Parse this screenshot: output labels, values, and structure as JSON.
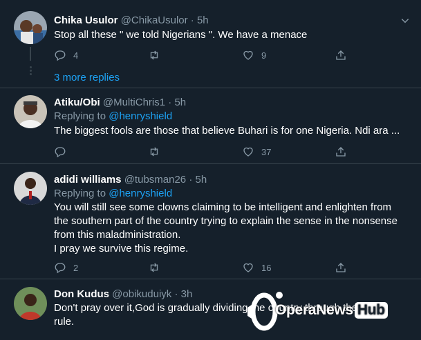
{
  "tweets": [
    {
      "name": "Chika Usulor",
      "handle": "@ChikaUsulor",
      "dot": "·",
      "time": "5h",
      "replying_label": "",
      "replying_to": "",
      "text": [
        "Stop all these \" we told Nigerians \". We have a menace"
      ],
      "replies": "4",
      "retweets": "",
      "likes": "9"
    },
    {
      "name": "Atiku/Obi",
      "handle": "@MultiChris1",
      "dot": "·",
      "time": "5h",
      "replying_label": "Replying to",
      "replying_to": "@henryshield",
      "text": [
        "The biggest fools are those that believe Buhari is for one Nigeria.  Ndi ara ..."
      ],
      "replies": "",
      "retweets": "",
      "likes": "37"
    },
    {
      "name": "adidi williams",
      "handle": "@tubsman26",
      "dot": "·",
      "time": "5h",
      "replying_label": "Replying to",
      "replying_to": "@henryshield",
      "text": [
        "You will still see some clowns claiming to be intelligent and enlighten from",
        "the southern part of the country trying to explain the sense in the nonsense",
        "from this maladministration.",
        "I pray we survive this regime."
      ],
      "replies": "2",
      "retweets": "",
      "likes": "16"
    },
    {
      "name": "Don Kudus",
      "handle": "@obikuduiyk",
      "dot": "·",
      "time": "3h",
      "replying_label": "",
      "replying_to": "",
      "text": [
        "Don't pray over it,God is gradually dividing the country through the be",
        "rule."
      ],
      "replies": "",
      "retweets": "",
      "likes": ""
    }
  ],
  "more_replies": "3 more replies",
  "watermark": {
    "brand": "OperaNews",
    "hub": "Hub"
  },
  "colors": {
    "background": "#15202b",
    "border": "#38444d",
    "muted": "#8899a6",
    "accent": "#1da1f2",
    "text": "#ffffff"
  },
  "icons": {
    "reply": "comment-bubble-icon",
    "retweet": "retweet-icon",
    "like": "heart-icon",
    "share": "share-icon",
    "caret": "chevron-down-icon"
  }
}
